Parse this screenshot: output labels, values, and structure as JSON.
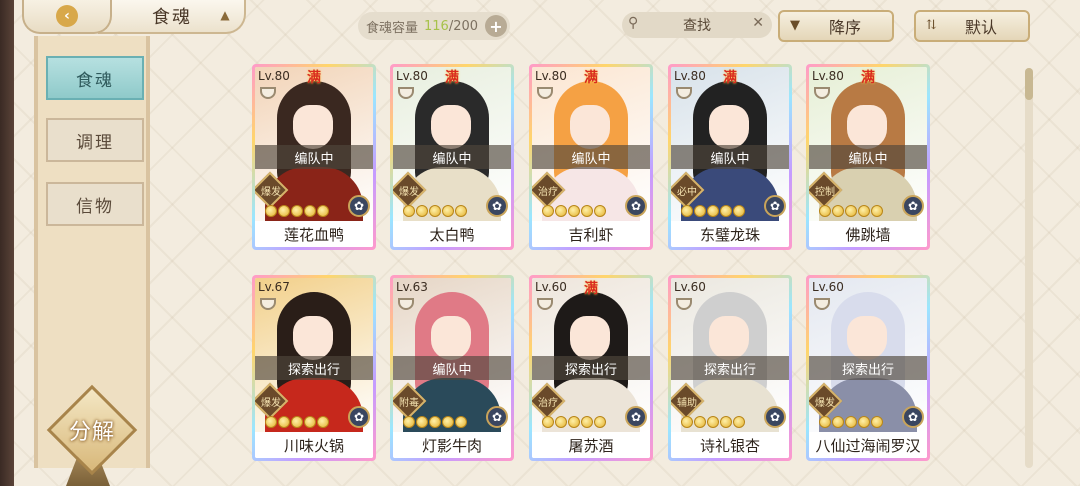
{
  "header": {
    "title": "食魂",
    "capacity_label": "食魂容量",
    "capacity_current": "116",
    "capacity_max": "/200",
    "search_label": "查找",
    "sort_order_label": "降序",
    "sort_mode_label": "默认"
  },
  "sidebar": {
    "tabs": [
      {
        "label": "食魂",
        "active": true
      },
      {
        "label": "调理",
        "active": false
      },
      {
        "label": "信物",
        "active": false
      }
    ],
    "decompose_label": "分解"
  },
  "colors": {
    "accent_teal": "#8fcaca",
    "capacity_green": "#a7c24a",
    "full_red": "#d92b1f"
  },
  "cards": [
    {
      "level": "Lv.80",
      "full": "满",
      "status": "编队中",
      "role": "爆发",
      "stars": 5,
      "name": "莲花血鸭",
      "hair": "#3a2820",
      "robe": "#8a2418",
      "bg": "#f2d4b8"
    },
    {
      "level": "Lv.80",
      "full": "满",
      "status": "编队中",
      "role": "爆发",
      "stars": 5,
      "name": "太白鸭",
      "hair": "#2a2a2a",
      "robe": "#e8dfc8",
      "bg": "#e8efdf"
    },
    {
      "level": "Lv.80",
      "full": "满",
      "status": "编队中",
      "role": "治疗",
      "stars": 5,
      "name": "吉利虾",
      "hair": "#f5a144",
      "robe": "#f6e6e6",
      "bg": "#fbe6d2"
    },
    {
      "level": "Lv.80",
      "full": "满",
      "status": "编队中",
      "role": "必中",
      "stars": 5,
      "name": "东璧龙珠",
      "hair": "#222222",
      "robe": "#3a4a7a",
      "bg": "#d8e2ea"
    },
    {
      "level": "Lv.80",
      "full": "满",
      "status": "编队中",
      "role": "控制",
      "stars": 5,
      "name": "佛跳墙",
      "hair": "#b87a44",
      "robe": "#d9d0b0",
      "bg": "#e6efd6"
    },
    {
      "level": "Lv.67",
      "full": "",
      "status": "探索出行",
      "role": "爆发",
      "stars": 5,
      "name": "川味火锅",
      "hair": "#2a1e18",
      "robe": "#c6281c",
      "bg": "#f2d08a"
    },
    {
      "level": "Lv.63",
      "full": "",
      "status": "编队中",
      "role": "附毒",
      "stars": 5,
      "name": "灯影牛肉",
      "hair": "#e07a86",
      "robe": "#2a4a5a",
      "bg": "#e6d6c6"
    },
    {
      "level": "Lv.60",
      "full": "满",
      "status": "探索出行",
      "role": "治疗",
      "stars": 5,
      "name": "屠苏酒",
      "hair": "#1e1a18",
      "robe": "#ece4d8",
      "bg": "#eee6dc"
    },
    {
      "level": "Lv.60",
      "full": "",
      "status": "探索出行",
      "role": "辅助",
      "stars": 5,
      "name": "诗礼银杏",
      "hair": "#cfcfcf",
      "robe": "#e8e2d2",
      "bg": "#ebe8e0"
    },
    {
      "level": "Lv.60",
      "full": "",
      "status": "探索出行",
      "role": "爆发",
      "stars": 5,
      "name": "八仙过海闹罗汉",
      "hair": "#d8dcec",
      "robe": "#8a8fa8",
      "bg": "#e4e8f0"
    }
  ]
}
